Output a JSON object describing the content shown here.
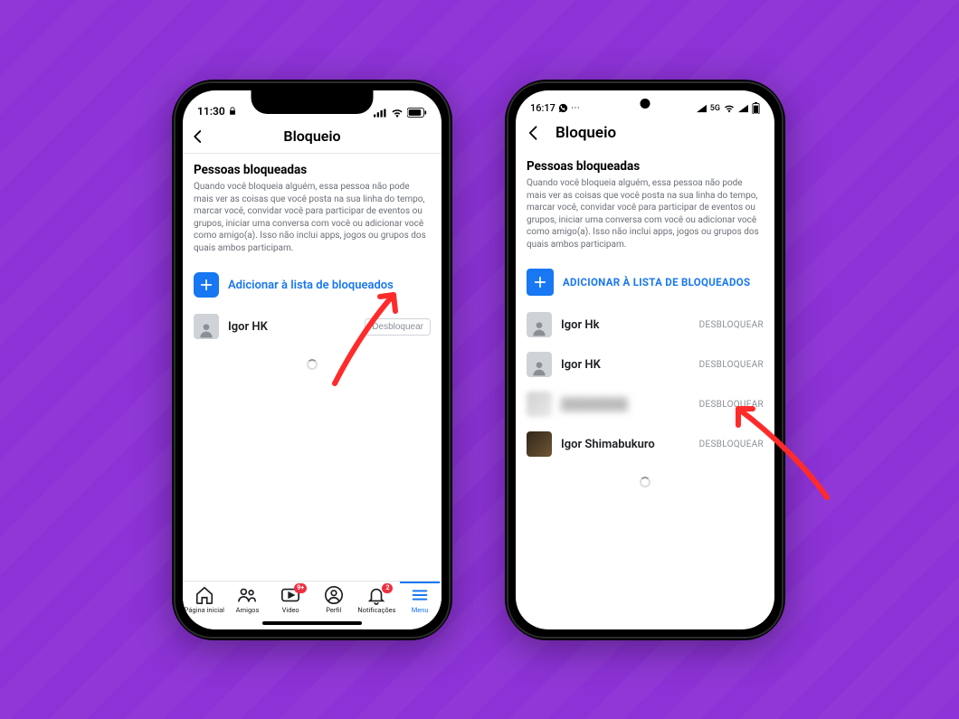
{
  "colors": {
    "accent": "#1877f2",
    "background": "#8c32d6",
    "badge": "#ef2e40",
    "arrow": "#ff2b2b"
  },
  "iphone": {
    "status": {
      "time": "11:30",
      "lock": "lock-icon"
    },
    "header": {
      "title": "Bloqueio"
    },
    "section": {
      "title": "Pessoas bloqueadas",
      "desc": "Quando você bloqueia alguém, essa pessoa não pode mais ver as coisas que você posta na sua linha do tempo, marcar você, convidar você para participar de eventos ou grupos, iniciar uma conversa com você ou adicionar você como amigo(a). Isso não inclui apps, jogos ou grupos dos quais ambos participam."
    },
    "add_label": "Adicionar à lista de bloqueados",
    "blocked": [
      {
        "name": "Igor HK",
        "action": "Desbloquear"
      }
    ],
    "tabs": [
      {
        "label": "Página inicial",
        "icon": "home-icon",
        "badge": ""
      },
      {
        "label": "Amigos",
        "icon": "friends-icon",
        "badge": ""
      },
      {
        "label": "Video",
        "icon": "video-icon",
        "badge": "9+"
      },
      {
        "label": "Perfil",
        "icon": "profile-icon",
        "badge": ""
      },
      {
        "label": "Notificações",
        "icon": "bell-icon",
        "badge": "2"
      },
      {
        "label": "Menu",
        "icon": "menu-icon",
        "badge": "",
        "active": true
      }
    ]
  },
  "android": {
    "status": {
      "time": "16:17",
      "network": "5G"
    },
    "header": {
      "title": "Bloqueio"
    },
    "section": {
      "title": "Pessoas bloqueadas",
      "desc": "Quando você bloqueia alguém, essa pessoa não pode mais ver as coisas que você posta na sua linha do tempo, marcar você, convidar você para participar de eventos ou grupos, iniciar uma conversa com você ou adicionar você como amigo(a). Isso não inclui apps, jogos ou grupos dos quais ambos participam."
    },
    "add_label": "ADICIONAR À LISTA DE BLOQUEADOS",
    "blocked": [
      {
        "name": "Igor Hk",
        "action": "DESBLOQUEAR"
      },
      {
        "name": "Igor HK",
        "action": "DESBLOQUEAR"
      },
      {
        "name": "████████",
        "action": "DESBLOQUEAR",
        "blurred": true
      },
      {
        "name": "Igor Shimabukuro",
        "action": "DESBLOQUEAR",
        "photo": true
      }
    ]
  }
}
